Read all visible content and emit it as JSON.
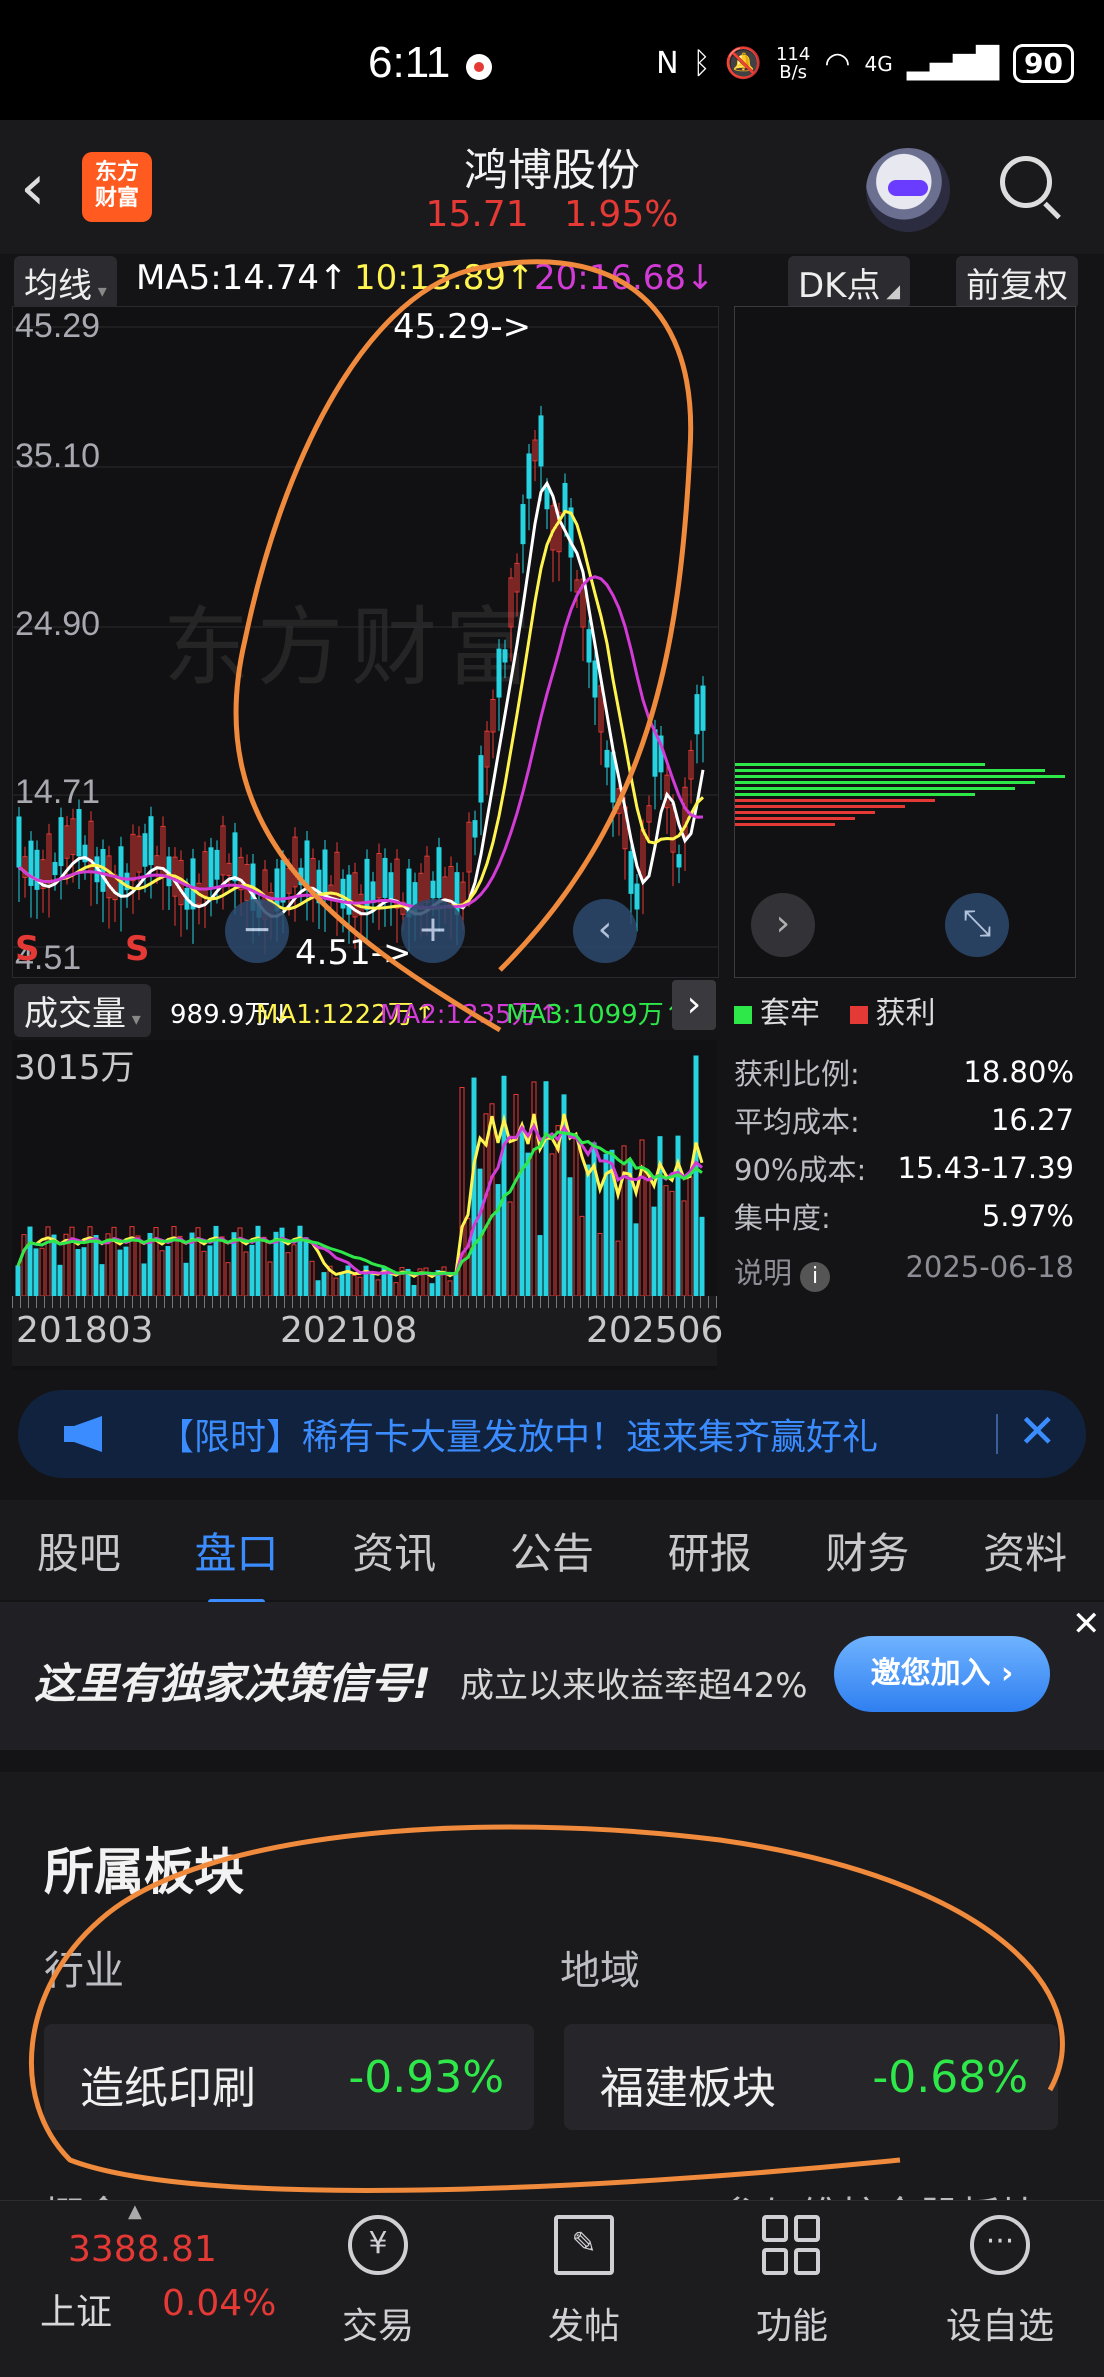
{
  "status_bar": {
    "time": "6:11",
    "net_speed_value": "114",
    "net_speed_unit": "B/s",
    "network": "4G",
    "battery": "90"
  },
  "header": {
    "logo_line1": "东方",
    "logo_line2": "财富",
    "stock_name": "鸿博股份",
    "price": "15.71",
    "change_pct": "1.95%"
  },
  "ma_bar": {
    "ma_toggle": "均线",
    "ma5": "MA5:14.74↑",
    "ma10": "10:13.89↑",
    "ma20": "20:16.68↓",
    "dk_select": "DK点",
    "adjust": "前复权"
  },
  "kline": {
    "y_labels": [
      "45.29",
      "35.10",
      "24.90",
      "14.71",
      "4.51"
    ],
    "high_marker": "45.29->",
    "low_marker": "4.51->",
    "signal_s1": "S",
    "signal_s2": "S",
    "watermark": "东方财富"
  },
  "volume": {
    "select_label": "成交量",
    "vol": "989.9万↓",
    "ma1": "MA1:1222万↑",
    "ma2": "MA2:1235万↑",
    "ma3": "MA3:1099万↑",
    "max_label": "3015万",
    "dates": [
      "201803",
      "202108",
      "202506"
    ]
  },
  "chip_panel": {
    "legend_trapped": "套牢",
    "legend_profit": "获利",
    "stats": [
      {
        "k": "获利比例:",
        "v": "18.80%"
      },
      {
        "k": "平均成本:",
        "v": "16.27"
      },
      {
        "k": "90%成本:",
        "v": "15.43-17.39"
      },
      {
        "k": "集中度:",
        "v": "5.97%"
      }
    ],
    "note_label": "说明",
    "date": "2025-06-18"
  },
  "banner": {
    "text": "【限时】稀有卡大量发放中！速来集齐赢好礼"
  },
  "tabs": [
    "股吧",
    "盘口",
    "资讯",
    "公告",
    "研报",
    "财务",
    "资料"
  ],
  "active_tab": "盘口",
  "ad": {
    "headline": "这里有独家决策信号!",
    "sub": "成立以来收益率超42%",
    "button": "邀您加入 ›"
  },
  "sector": {
    "title": "所属板块",
    "industry_label": "行业",
    "region_label": "地域",
    "industry_name": "造纸印刷",
    "industry_pct": "-0.93%",
    "region_name": "福建板块",
    "region_pct": "-0.68%",
    "concept_partial": "概念",
    "concept_right": "参与维护全股板块"
  },
  "bottom_nav": {
    "index_value": "3388.81",
    "index_name": "上证",
    "index_pct": "0.04%",
    "items": [
      "交易",
      "发帖",
      "功能",
      "设自选"
    ]
  },
  "colors": {
    "up": "#e53935",
    "down": "#2ee84a",
    "accent": "#3b8cff",
    "ma5": "#ffffff",
    "ma10": "#fff44f",
    "ma20": "#d23bd6",
    "annotation": "#f08a3c"
  }
}
